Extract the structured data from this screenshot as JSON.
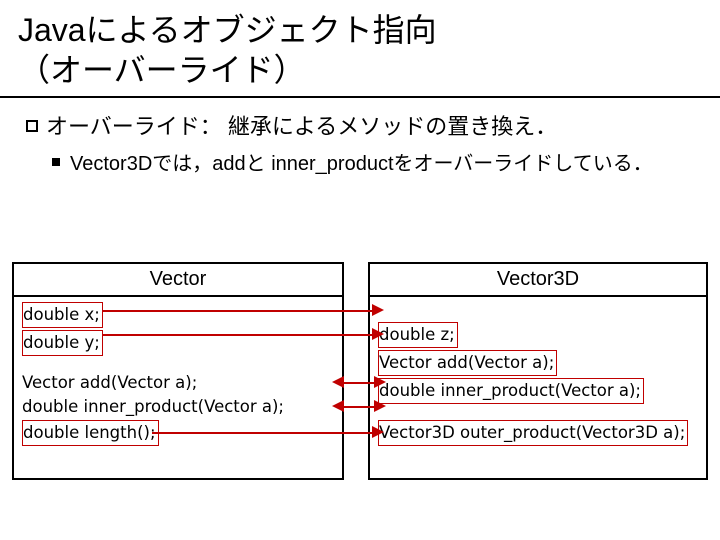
{
  "title": "Javaによるオブジェクト指向\n（オーバーライド）",
  "bullet1": "オーバーライド： 継承によるメソッドの置き換え．",
  "bullet2": "Vector3Dでは，addと inner_productをオーバーライドしている．",
  "left_class": {
    "name": "Vector",
    "field1": "double x;",
    "field2": "double y;",
    "m1": "Vector add(Vector a);",
    "m2": "double inner_product(Vector a);",
    "m3": "double length();"
  },
  "right_class": {
    "name": "Vector3D",
    "field1": "double z;",
    "m1": "Vector add(Vector a);",
    "m2": "double inner_product(Vector a);",
    "m3": "Vector3D outer_product(Vector3D a);"
  }
}
